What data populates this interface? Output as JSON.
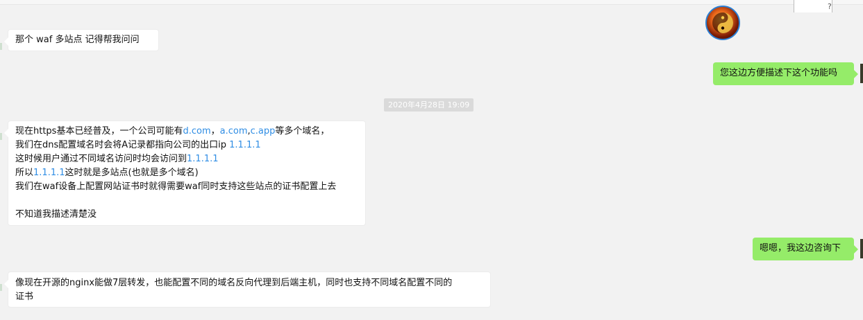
{
  "chat": {
    "timestamp": "2020年4月28日 19:09",
    "messages": [
      {
        "side": "left",
        "lines": [
          "那个  waf 多站点  记得帮我问问"
        ]
      },
      {
        "side": "right",
        "text": "您这边方便描述下这个功能吗"
      },
      {
        "side": "left",
        "lines": [
          "现在https基本已经普及，一个公司可能有",
          "d.com",
          "，",
          "a.com",
          ",",
          "c.app",
          "等多个域名，",
          "我们在dns配置域名时会将A记录都指向公司的出口ip ",
          "1.1.1.1",
          "这时候用户通过不同域名访问时均会访问到",
          "1.1.1.1",
          "所以",
          "1.1.1.1",
          "这时就是多站点(也就是多个域名)",
          "我们在waf设备上配置网站证书时就得需要waf同时支持这些站点的证书配置上去",
          "不知道我描述清楚没"
        ]
      },
      {
        "side": "right",
        "text": "嗯嗯，我这边咨询下"
      },
      {
        "side": "left",
        "lines": [
          "像现在开源的nginx能做7层转发，也能配置不同的域名反向代理到后端主机，同时也支持不同域名配置不同的",
          "证书"
        ]
      }
    ]
  },
  "colors": {
    "background": "#f2f2f2",
    "sent_bubble": "#95ec69",
    "received_bubble": "#ffffff",
    "link": "#2f8de4",
    "timestamp_bg": "#dadada"
  }
}
